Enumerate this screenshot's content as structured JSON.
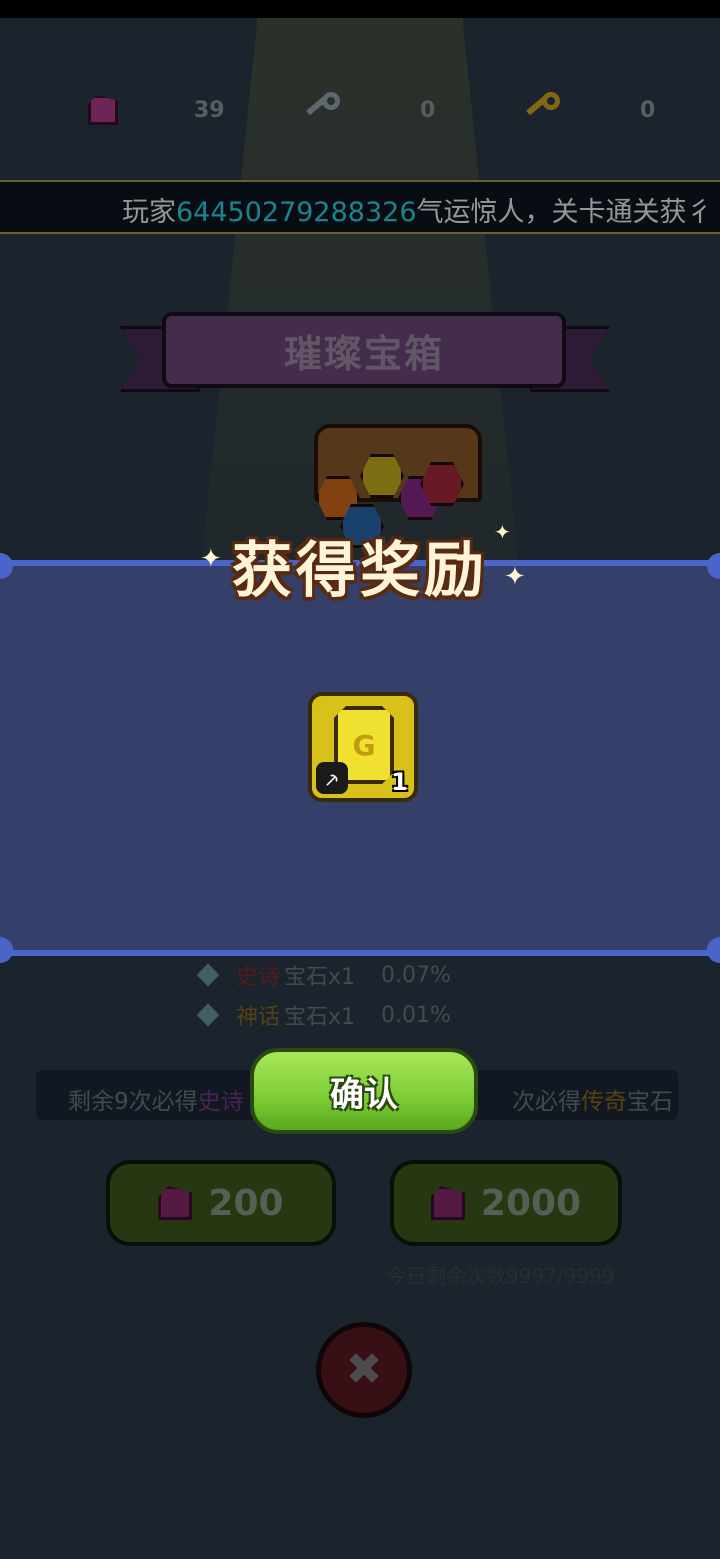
{
  "resources": {
    "gems": "39",
    "silver_keys": "0",
    "gold_keys": "0"
  },
  "ticker": {
    "prefix": "玩家",
    "player_id": "64450279288326",
    "suffix": "气运惊人，关卡通关获彳"
  },
  "chest": {
    "title": "璀璨宝箱"
  },
  "probabilities": {
    "row1": {
      "rarity": "史诗",
      "item": "宝石x1",
      "chance": "0.07%"
    },
    "row2": {
      "rarity": "神话",
      "item": "宝石x1",
      "chance": "0.01%"
    }
  },
  "pity": {
    "left_prefix": "剩余9次必得",
    "left_rarity": "史诗",
    "right_prefix": "次必得",
    "right_rarity": "传奇",
    "right_suffix": "宝石"
  },
  "buy_buttons": [
    {
      "label": "200"
    },
    {
      "label": "2000"
    }
  ],
  "daily_limit": "今日剩余次数9997/9999",
  "reward_popup": {
    "title": "获得奖励",
    "item": {
      "count": "1",
      "badge_icon": "pickaxe-icon",
      "color": "#f0e030"
    },
    "confirm_label": "确认"
  },
  "colors": {
    "player_id": "#2fd3e0",
    "panel_border": "#4b64c8",
    "confirm_green": "#7ccc34"
  }
}
